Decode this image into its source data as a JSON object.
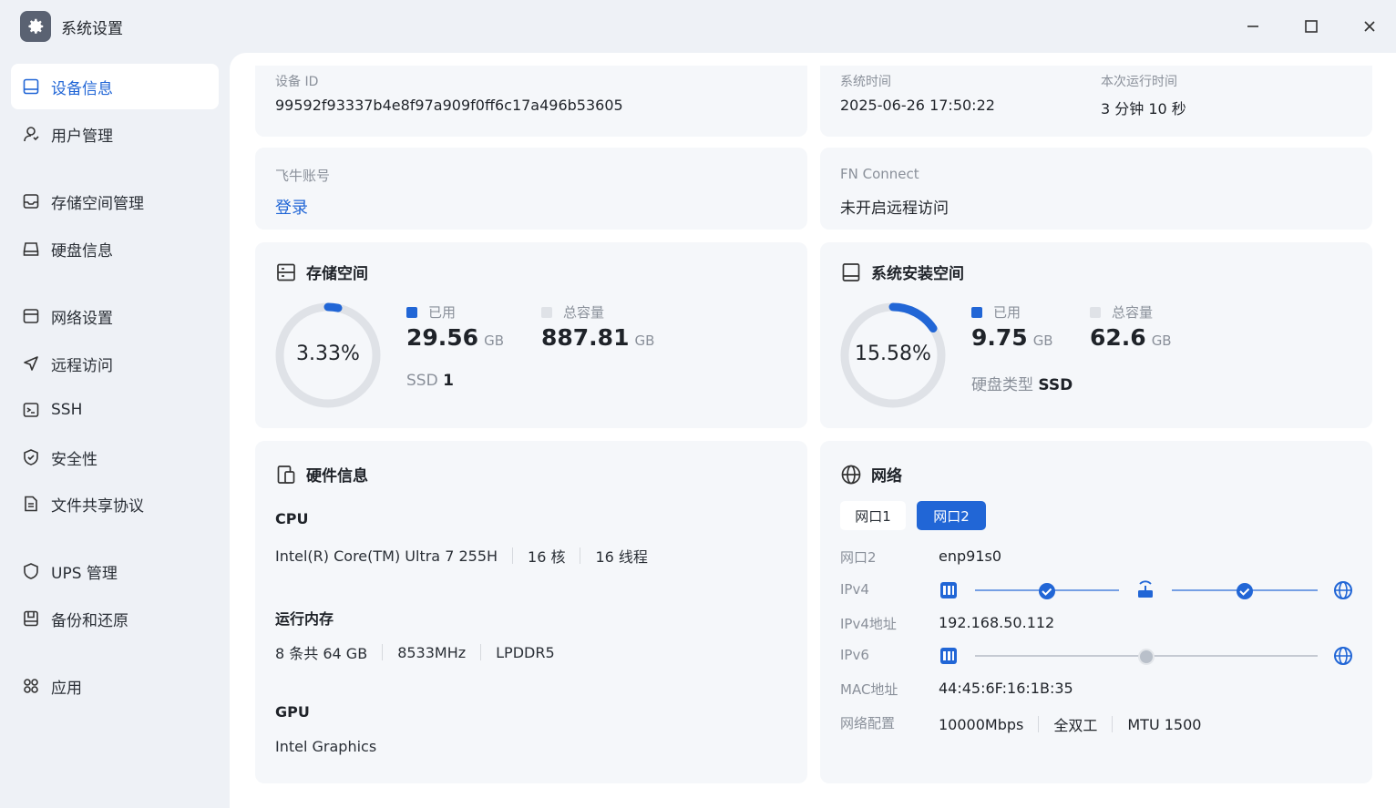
{
  "window": {
    "title": "系统设置"
  },
  "sidebar": {
    "items": [
      {
        "label": "设备信息",
        "icon": "device-icon",
        "active": true
      },
      {
        "label": "用户管理",
        "icon": "user-icon"
      },
      {
        "label": "存储空间管理",
        "icon": "storage-icon"
      },
      {
        "label": "硬盘信息",
        "icon": "disk-icon"
      },
      {
        "label": "网络设置",
        "icon": "network-icon"
      },
      {
        "label": "远程访问",
        "icon": "send-icon"
      },
      {
        "label": "SSH",
        "icon": "terminal-icon"
      },
      {
        "label": "安全性",
        "icon": "shield-check-icon"
      },
      {
        "label": "文件共享协议",
        "icon": "file-icon"
      },
      {
        "label": "UPS 管理",
        "icon": "ups-shield-icon"
      },
      {
        "label": "备份和还原",
        "icon": "backup-icon"
      },
      {
        "label": "应用",
        "icon": "apps-icon"
      }
    ]
  },
  "device": {
    "id_label": "设备 ID",
    "id_value": "99592f93337b4e8f97a909f0ff6c17a496b53605",
    "time_label": "系统时间",
    "time_value": "2025-06-26 17:50:22",
    "uptime_label": "本次运行时间",
    "uptime_value": "3 分钟 10 秒"
  },
  "account": {
    "label": "飞牛账号",
    "login": "登录"
  },
  "fn_connect": {
    "label": "FN Connect",
    "value": "未开启远程访问"
  },
  "storage": {
    "title": "存储空间",
    "percent_text": "3.33%",
    "percent": 0.0333,
    "used_label": "已用",
    "used_value": "29.56",
    "used_unit": "GB",
    "total_label": "总容量",
    "total_value": "887.81",
    "total_unit": "GB",
    "ssd_label": "SSD",
    "ssd_count": "1"
  },
  "system_space": {
    "title": "系统安装空间",
    "percent_text": "15.58%",
    "percent": 0.1558,
    "used_label": "已用",
    "used_value": "9.75",
    "used_unit": "GB",
    "total_label": "总容量",
    "total_value": "62.6",
    "total_unit": "GB",
    "disk_type_label": "硬盘类型",
    "disk_type_value": "SSD"
  },
  "hardware": {
    "title": "硬件信息",
    "cpu_label": "CPU",
    "cpu_model": "Intel(R) Core(TM) Ultra 7 255H",
    "cpu_cores": "16 核",
    "cpu_threads": "16 线程",
    "mem_label": "运行内存",
    "mem_size": "8 条共 64 GB",
    "mem_speed": "8533MHz",
    "mem_type": "LPDDR5",
    "gpu_label": "GPU",
    "gpu_model": "Intel Graphics"
  },
  "network": {
    "title": "网络",
    "tabs": [
      "网口1",
      "网口2"
    ],
    "active_tab": 1,
    "port_label": "网口2",
    "port_value": "enp91s0",
    "ipv4_label": "IPv4",
    "ipv4_addr_label": "IPv4地址",
    "ipv4_addr_value": "192.168.50.112",
    "ipv6_label": "IPv6",
    "mac_label": "MAC地址",
    "mac_value": "44:45:6F:16:1B:35",
    "config_label": "网络配置",
    "config_speed": "10000Mbps",
    "config_duplex": "全双工",
    "config_mtu": "MTU 1500"
  },
  "colors": {
    "accent": "#2166d6",
    "ring_track": "#dfe2e7",
    "card_bg": "#f5f7fa"
  }
}
